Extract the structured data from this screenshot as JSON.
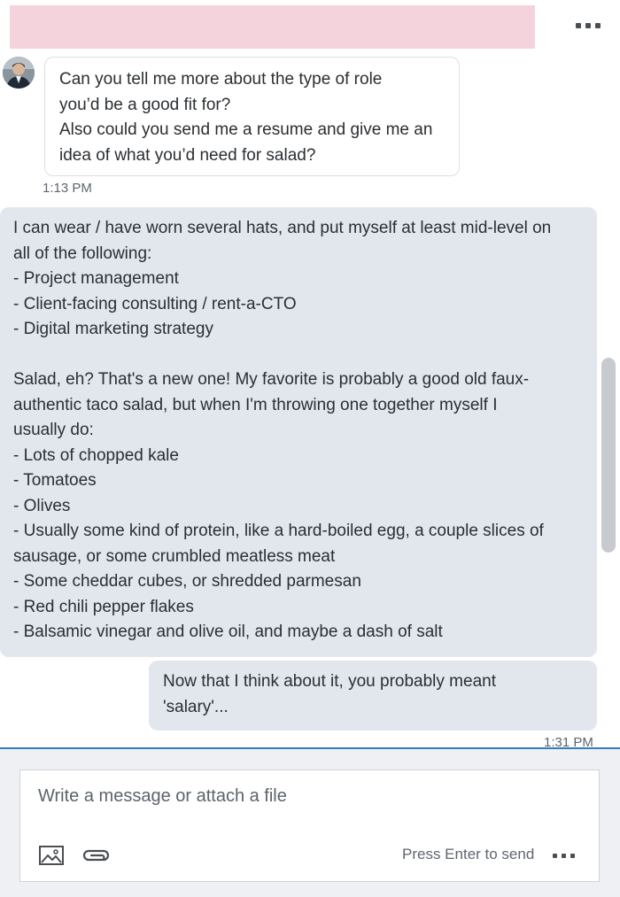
{
  "conversation": {
    "messages": [
      {
        "direction": "incoming",
        "text": "Can you tell me more about the type of role\nyou’d be a good fit for?\nAlso could you send me a resume and give me an\nidea of what you’d need for salad?",
        "time": "1:13 PM"
      },
      {
        "direction": "outgoing",
        "text": "I can wear / have worn several hats, and put myself at least mid-level on\nall of the following:\n- Project management\n- Client-facing consulting / rent-a-CTO\n- Digital marketing strategy\n\nSalad, eh? That's a new one! My favorite is probably a good old faux-\nauthentic taco salad, but when I'm throwing one together myself I\nusually do:\n- Lots of chopped kale\n- Tomatoes\n- Olives\n- Usually some kind of protein, like a hard-boiled egg, a couple slices of\nsausage, or some crumbled meatless meat\n- Some cheddar cubes, or shredded parmesan\n- Red chili pepper flakes\n- Balsamic vinegar and olive oil, and maybe a dash of salt"
      },
      {
        "direction": "outgoing",
        "text": "Now that I think about it, you probably meant\n'salary'...",
        "time": "1:31 PM"
      }
    ]
  },
  "compose": {
    "placeholder": "Write a message or attach a file",
    "hint": "Press Enter to send"
  },
  "icons": {
    "header_more": "more-horizontal-icon",
    "image": "image-icon",
    "attach": "paperclip-icon",
    "compose_more": "more-horizontal-icon"
  },
  "colors": {
    "accent": "#2f7fbe",
    "outgoing_bubble": "#e2e7ed",
    "redaction": "#f5d3dd"
  }
}
